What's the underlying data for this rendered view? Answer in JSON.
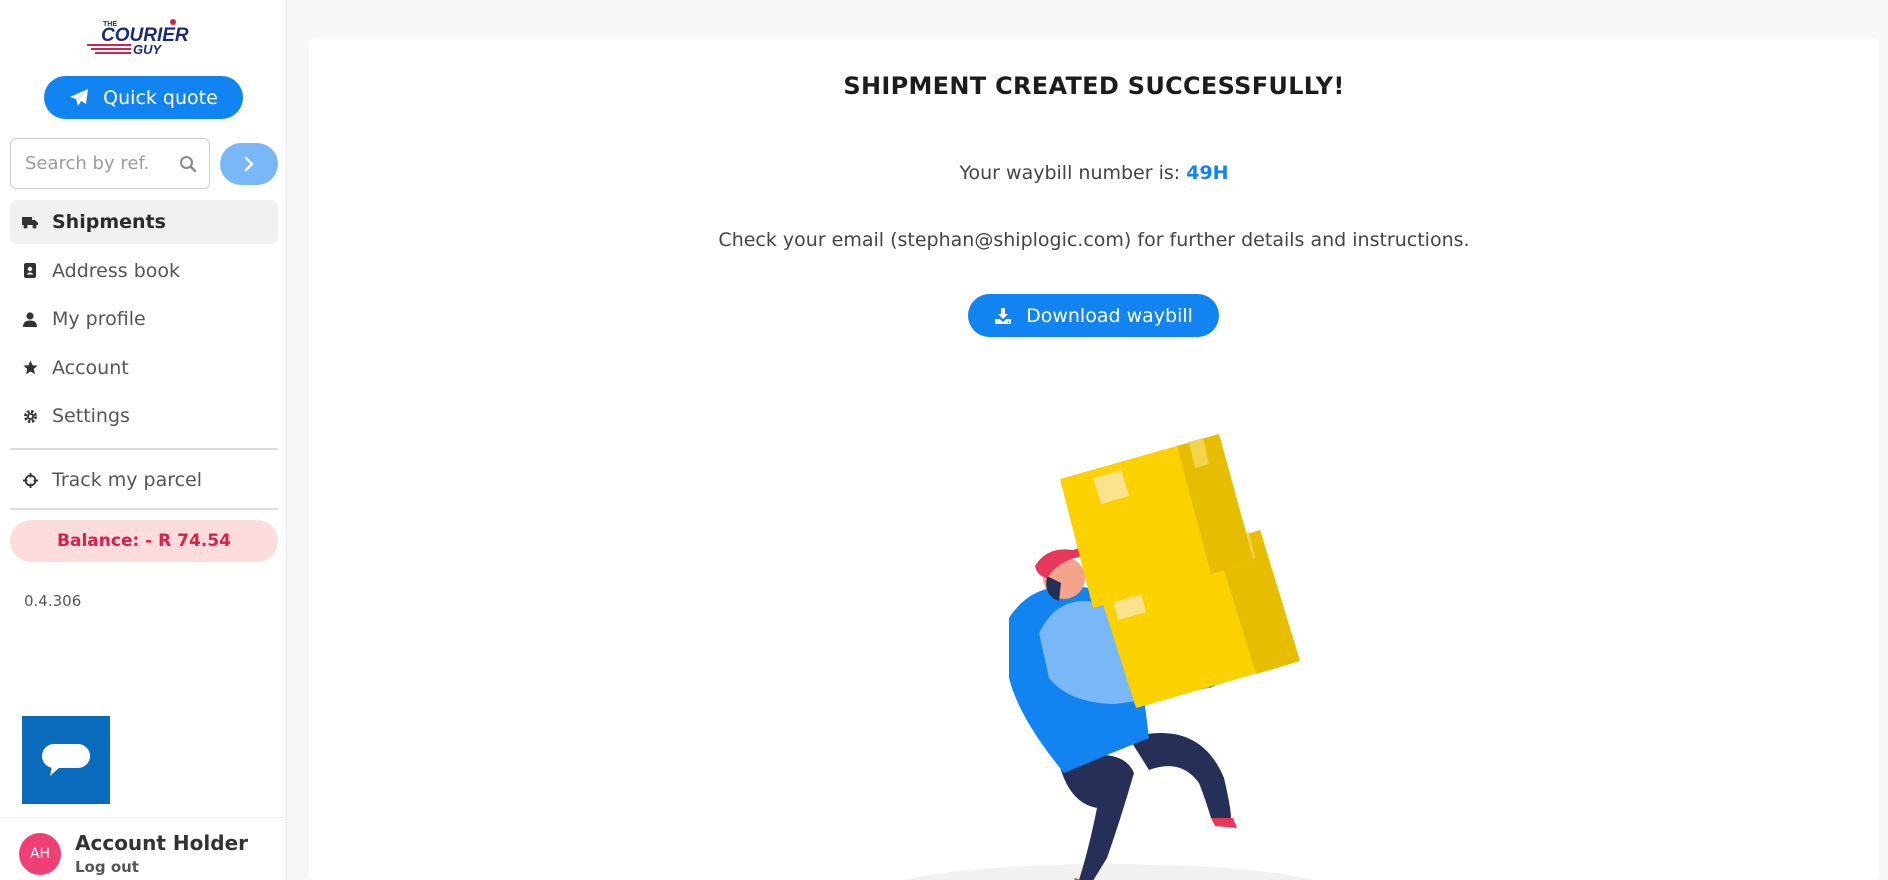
{
  "sidebar": {
    "logo_text": "THE COURIER GUY",
    "quick_quote_label": "Quick quote",
    "search_placeholder": "Search by ref.",
    "nav": [
      {
        "label": "Shipments",
        "icon": "truck-icon",
        "active": true
      },
      {
        "label": "Address book",
        "icon": "address-book-icon"
      },
      {
        "label": "My profile",
        "icon": "user-icon"
      },
      {
        "label": "Account",
        "icon": "star-icon"
      },
      {
        "label": "Settings",
        "icon": "gear-icon"
      }
    ],
    "track_label": "Track my parcel",
    "balance_text": "Balance: - R 74.54",
    "version": "0.4.306"
  },
  "user": {
    "initials": "AH",
    "name": "Account Holder",
    "logout_label": "Log out"
  },
  "main": {
    "title": "SHIPMENT CREATED SUCCESSFULLY!",
    "waybill_prefix": "Your waybill number is: ",
    "waybill_number": "49H",
    "email_line": "Check your email (stephan@shiplogic.com) for further details and instructions.",
    "download_label": "Download waybill"
  },
  "colors": {
    "primary": "#1184f2",
    "balance_bg": "#fcdcdc",
    "balance_text": "#d8204a",
    "chat_bg": "#0a6bbd",
    "avatar_bg": "#f03e77"
  }
}
